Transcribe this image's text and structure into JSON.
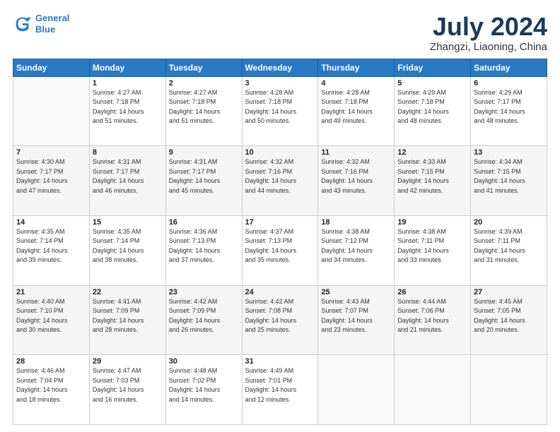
{
  "logo": {
    "line1": "General",
    "line2": "Blue"
  },
  "title": "July 2024",
  "subtitle": "Zhangzi, Liaoning, China",
  "days_header": [
    "Sunday",
    "Monday",
    "Tuesday",
    "Wednesday",
    "Thursday",
    "Friday",
    "Saturday"
  ],
  "weeks": [
    [
      {
        "day": "",
        "info": ""
      },
      {
        "day": "1",
        "info": "Sunrise: 4:27 AM\nSunset: 7:18 PM\nDaylight: 14 hours\nand 51 minutes."
      },
      {
        "day": "2",
        "info": "Sunrise: 4:27 AM\nSunset: 7:18 PM\nDaylight: 14 hours\nand 51 minutes."
      },
      {
        "day": "3",
        "info": "Sunrise: 4:28 AM\nSunset: 7:18 PM\nDaylight: 14 hours\nand 50 minutes."
      },
      {
        "day": "4",
        "info": "Sunrise: 4:28 AM\nSunset: 7:18 PM\nDaylight: 14 hours\nand 49 minutes."
      },
      {
        "day": "5",
        "info": "Sunrise: 4:29 AM\nSunset: 7:18 PM\nDaylight: 14 hours\nand 48 minutes."
      },
      {
        "day": "6",
        "info": "Sunrise: 4:29 AM\nSunset: 7:17 PM\nDaylight: 14 hours\nand 48 minutes."
      }
    ],
    [
      {
        "day": "7",
        "info": "Sunrise: 4:30 AM\nSunset: 7:17 PM\nDaylight: 14 hours\nand 47 minutes."
      },
      {
        "day": "8",
        "info": "Sunrise: 4:31 AM\nSunset: 7:17 PM\nDaylight: 14 hours\nand 46 minutes."
      },
      {
        "day": "9",
        "info": "Sunrise: 4:31 AM\nSunset: 7:17 PM\nDaylight: 14 hours\nand 45 minutes."
      },
      {
        "day": "10",
        "info": "Sunrise: 4:32 AM\nSunset: 7:16 PM\nDaylight: 14 hours\nand 44 minutes."
      },
      {
        "day": "11",
        "info": "Sunrise: 4:32 AM\nSunset: 7:16 PM\nDaylight: 14 hours\nand 43 minutes."
      },
      {
        "day": "12",
        "info": "Sunrise: 4:33 AM\nSunset: 7:15 PM\nDaylight: 14 hours\nand 42 minutes."
      },
      {
        "day": "13",
        "info": "Sunrise: 4:34 AM\nSunset: 7:15 PM\nDaylight: 14 hours\nand 41 minutes."
      }
    ],
    [
      {
        "day": "14",
        "info": "Sunrise: 4:35 AM\nSunset: 7:14 PM\nDaylight: 14 hours\nand 39 minutes."
      },
      {
        "day": "15",
        "info": "Sunrise: 4:35 AM\nSunset: 7:14 PM\nDaylight: 14 hours\nand 38 minutes."
      },
      {
        "day": "16",
        "info": "Sunrise: 4:36 AM\nSunset: 7:13 PM\nDaylight: 14 hours\nand 37 minutes."
      },
      {
        "day": "17",
        "info": "Sunrise: 4:37 AM\nSunset: 7:13 PM\nDaylight: 14 hours\nand 35 minutes."
      },
      {
        "day": "18",
        "info": "Sunrise: 4:38 AM\nSunset: 7:12 PM\nDaylight: 14 hours\nand 34 minutes."
      },
      {
        "day": "19",
        "info": "Sunrise: 4:38 AM\nSunset: 7:11 PM\nDaylight: 14 hours\nand 33 minutes."
      },
      {
        "day": "20",
        "info": "Sunrise: 4:39 AM\nSunset: 7:11 PM\nDaylight: 14 hours\nand 31 minutes."
      }
    ],
    [
      {
        "day": "21",
        "info": "Sunrise: 4:40 AM\nSunset: 7:10 PM\nDaylight: 14 hours\nand 30 minutes."
      },
      {
        "day": "22",
        "info": "Sunrise: 4:41 AM\nSunset: 7:09 PM\nDaylight: 14 hours\nand 28 minutes."
      },
      {
        "day": "23",
        "info": "Sunrise: 4:42 AM\nSunset: 7:09 PM\nDaylight: 14 hours\nand 26 minutes."
      },
      {
        "day": "24",
        "info": "Sunrise: 4:42 AM\nSunset: 7:08 PM\nDaylight: 14 hours\nand 25 minutes."
      },
      {
        "day": "25",
        "info": "Sunrise: 4:43 AM\nSunset: 7:07 PM\nDaylight: 14 hours\nand 23 minutes."
      },
      {
        "day": "26",
        "info": "Sunrise: 4:44 AM\nSunset: 7:06 PM\nDaylight: 14 hours\nand 21 minutes."
      },
      {
        "day": "27",
        "info": "Sunrise: 4:45 AM\nSunset: 7:05 PM\nDaylight: 14 hours\nand 20 minutes."
      }
    ],
    [
      {
        "day": "28",
        "info": "Sunrise: 4:46 AM\nSunset: 7:04 PM\nDaylight: 14 hours\nand 18 minutes."
      },
      {
        "day": "29",
        "info": "Sunrise: 4:47 AM\nSunset: 7:03 PM\nDaylight: 14 hours\nand 16 minutes."
      },
      {
        "day": "30",
        "info": "Sunrise: 4:48 AM\nSunset: 7:02 PM\nDaylight: 14 hours\nand 14 minutes."
      },
      {
        "day": "31",
        "info": "Sunrise: 4:49 AM\nSunset: 7:01 PM\nDaylight: 14 hours\nand 12 minutes."
      },
      {
        "day": "",
        "info": ""
      },
      {
        "day": "",
        "info": ""
      },
      {
        "day": "",
        "info": ""
      }
    ]
  ]
}
